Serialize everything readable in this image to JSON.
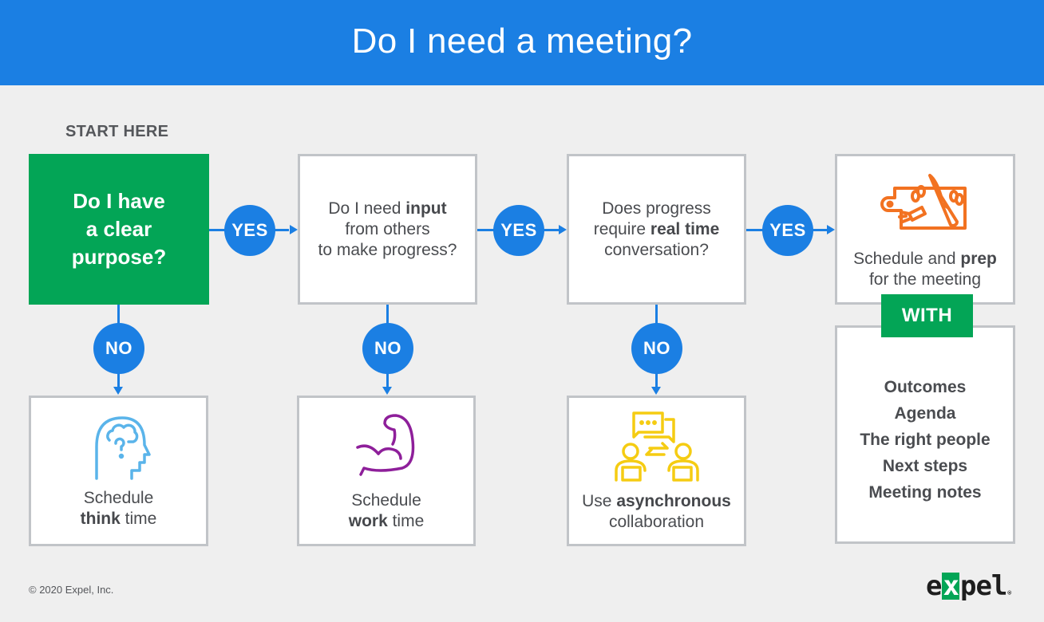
{
  "header": {
    "title": "Do I need a meeting?"
  },
  "start_label": "START HERE",
  "colors": {
    "primary_blue": "#1b7fe3",
    "green": "#03a556",
    "border_gray": "#c1c4c8",
    "text_dark": "#4a4c50",
    "icon_think": "#5ab4ea",
    "icon_work": "#8e1f9a",
    "icon_async": "#f5cc12",
    "icon_prep": "#f27221"
  },
  "questions": [
    {
      "lines": [
        "Do I have",
        "a clear",
        "purpose?"
      ]
    },
    {
      "line1_pre": "Do I need ",
      "line1_bold": "input",
      "line2": "from others",
      "line3": "to make progress?"
    },
    {
      "line1": "Does progress",
      "line2_pre": "require ",
      "line2_bold": "real time",
      "line3": "conversation?"
    }
  ],
  "yes_label": "YES",
  "no_label": "NO",
  "outcomes": {
    "think": {
      "icon": "head-question-icon",
      "line1": "Schedule",
      "bold": "think",
      "rest": " time"
    },
    "work": {
      "icon": "flexed-arm-icon",
      "line1": "Schedule",
      "bold": "work",
      "rest": " time"
    },
    "async": {
      "icon": "async-collaboration-icon",
      "pre": "Use ",
      "bold": "asynchronous",
      "line2": "collaboration"
    },
    "prep": {
      "icon": "cutting-board-knife-icon",
      "pre": "Schedule and ",
      "bold": "prep",
      "line2": "for the meeting"
    }
  },
  "with_label": "WITH",
  "with_items": [
    "Outcomes",
    "Agenda",
    "The right people",
    "Next steps",
    "Meeting notes"
  ],
  "footer": {
    "copyright": "© 2020 Expel, Inc."
  },
  "logo": {
    "pre": "e",
    "x": "x",
    "post": "pel",
    "mark": "®"
  }
}
